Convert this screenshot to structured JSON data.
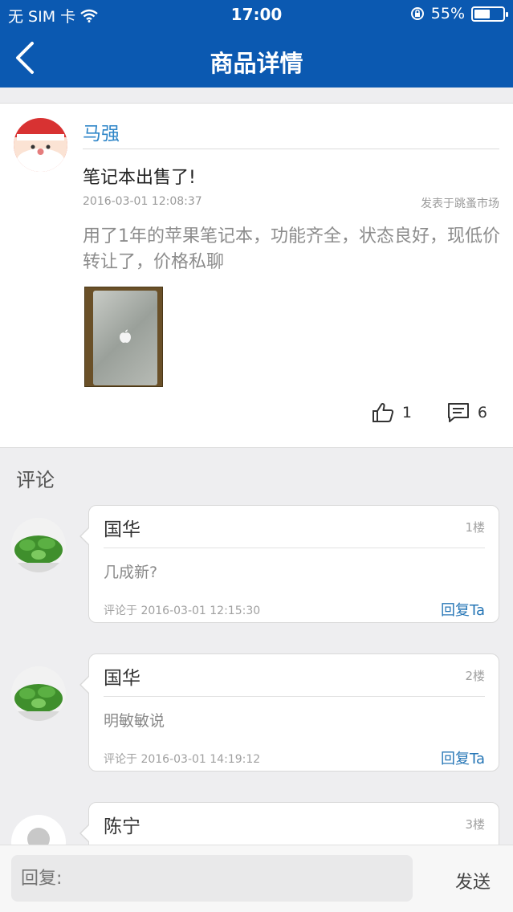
{
  "status_bar": {
    "carrier": "无 SIM 卡",
    "time": "17:00",
    "battery": "55%",
    "battery_level": 0.55
  },
  "header": {
    "title": "商品详情"
  },
  "post": {
    "author": "马强",
    "title": "笔记本出售了!",
    "time": "2016-03-01 12:08:37",
    "source": "发表于跳蚤市场",
    "body": "用了1年的苹果笔记本，功能齐全，状态良好，现低价转让了，价格私聊",
    "likes": "1",
    "comments": "6"
  },
  "comments_section": {
    "label": "评论",
    "items": [
      {
        "name": "国华",
        "floor": "1楼",
        "text": "几成新?",
        "time": "评论于 2016-03-01 12:15:30",
        "reply": "回复Ta"
      },
      {
        "name": "国华",
        "floor": "2楼",
        "text": "明敏敏说",
        "time": "评论于 2016-03-01 14:19:12",
        "reply": "回复Ta"
      },
      {
        "name": "陈宁",
        "floor": "3楼"
      }
    ]
  },
  "bottom_bar": {
    "placeholder": "回复:",
    "send": "发送"
  },
  "colors": {
    "header_bg": "#0b59b1",
    "link": "#2f86c8",
    "reply": "#2676b6"
  }
}
